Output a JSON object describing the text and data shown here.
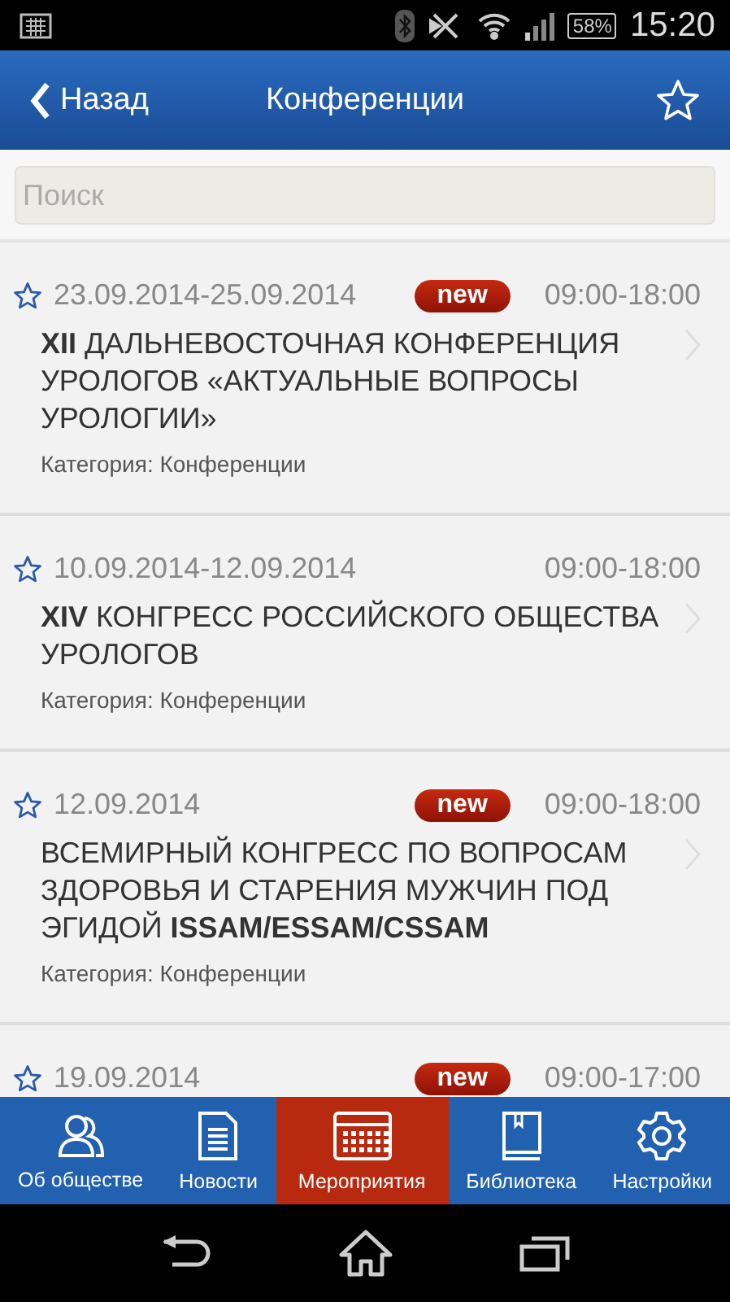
{
  "status_bar": {
    "battery": "58%",
    "time": "15:20"
  },
  "header": {
    "back": "Назад",
    "title": "Конференции"
  },
  "search": {
    "placeholder": "Поиск"
  },
  "events": [
    {
      "date": "23.09.2014-25.09.2014",
      "badge": "new",
      "time": "09:00-18:00",
      "title": "**XII** ДАЛЬНЕВОСТОЧНАЯ КОНФЕРЕНЦИЯ УРОЛОГОВ «АКТУАЛЬНЫЕ ВОПРОСЫ УРОЛОГИИ»",
      "category": "Категория: Конференции"
    },
    {
      "date": "10.09.2014-12.09.2014",
      "time": "09:00-18:00",
      "title": "**XIV** КОНГРЕСС РОССИЙСКОГО ОБЩЕСТВА УРОЛОГОВ",
      "category": "Категория: Конференции"
    },
    {
      "date": "12.09.2014",
      "badge": "new",
      "time": "09:00-18:00",
      "title": "ВСЕМИРНЫЙ КОНГРЕСС ПО ВОПРОСАМ ЗДОРОВЬЯ И СТАРЕНИЯ МУЖЧИН ПОД ЭГИДОЙ **ISSAM/ESSAM/CSSAM**",
      "category": "Категория: Конференции"
    },
    {
      "date": "19.09.2014",
      "badge": "new",
      "time": "09:00-17:00"
    }
  ],
  "tabs": [
    {
      "label": "Об обществе",
      "selected": false
    },
    {
      "label": "Новости",
      "selected": false
    },
    {
      "label": "Мероприятия",
      "selected": true
    },
    {
      "label": "Библиотека",
      "selected": false
    },
    {
      "label": "Настройки",
      "selected": false
    }
  ]
}
